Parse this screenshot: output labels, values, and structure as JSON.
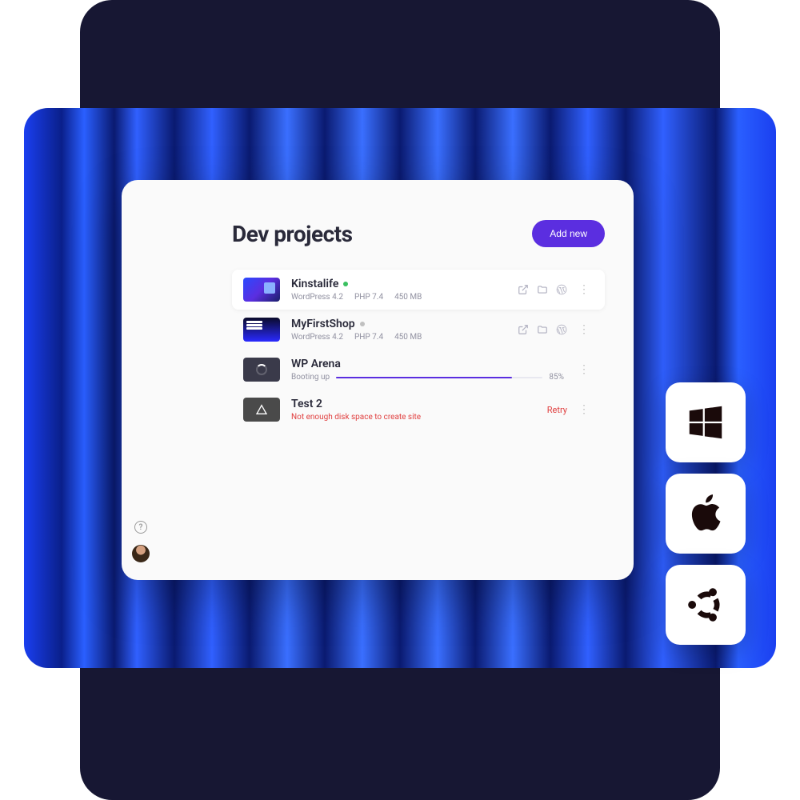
{
  "header": {
    "title": "Dev projects",
    "add_label": "Add new"
  },
  "projects": [
    {
      "name": "Kinstalife",
      "status": "running",
      "wp": "WordPress 4.2",
      "php": "PHP 7.4",
      "size": "450 MB"
    },
    {
      "name": "MyFirstShop",
      "status": "idle",
      "wp": "WordPress 4.2",
      "php": "PHP 7.4",
      "size": "450 MB"
    },
    {
      "name": "WP Arena",
      "status_label": "Booting up",
      "progress": 85,
      "progress_label": "85%"
    },
    {
      "name": "Test 2",
      "error": "Not enough disk space to create site",
      "retry_label": "Retry"
    }
  ],
  "os": [
    "windows",
    "apple",
    "ubuntu"
  ]
}
